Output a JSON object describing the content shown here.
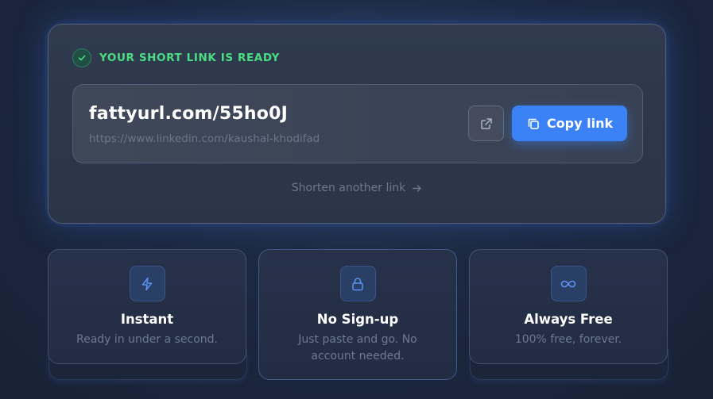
{
  "result": {
    "status_text": "YOUR SHORT LINK IS READY",
    "short_url": "fattyurl.com/55ho0J",
    "original_url": "https://www.linkedin.com/kaushal-khodifad",
    "copy_label": "Copy link",
    "shorten_another_label": "Shorten another link",
    "status_color": "#4ade80",
    "accent_color": "#3b82f6",
    "icons": {
      "status": "check-icon",
      "open": "external-link-icon",
      "copy": "copy-icon",
      "shorten_another": "arrow-right-icon"
    }
  },
  "features": [
    {
      "icon": "lightning-bolt-icon",
      "title": "Instant",
      "description": "Ready in under a second."
    },
    {
      "icon": "lock-icon",
      "title": "No Sign-up",
      "description_line1": "Just paste and go. No",
      "description_line2": "account needed."
    },
    {
      "icon": "infinity-icon",
      "title": "Always Free",
      "description": "100% free, forever."
    }
  ]
}
